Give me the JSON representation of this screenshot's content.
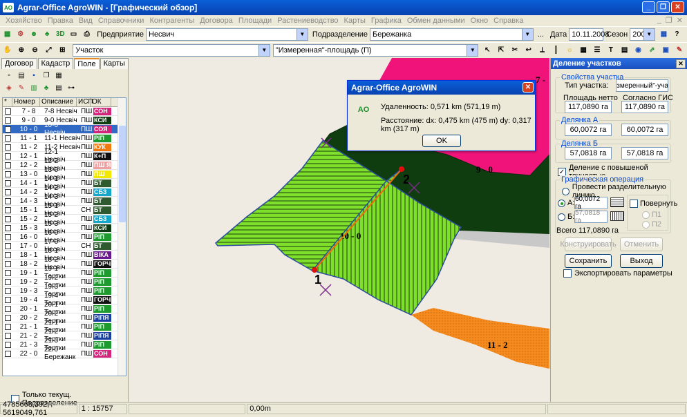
{
  "window": {
    "title": "Agrar-Office AgroWIN - [Графический обзор]",
    "app_icon": "AO"
  },
  "menu": [
    "Хозяйство",
    "Правка",
    "Вид",
    "Справочники",
    "Контрагенты",
    "Договора",
    "Площади",
    "Растениеводство",
    "Карты",
    "Графика",
    "Обмен данными",
    "Окно",
    "Справка"
  ],
  "toolbar1": {
    "enterprise_label": "Предприятие",
    "enterprise_value": "Несвич",
    "division_label": "Подразделение",
    "division_value": "Бережанка",
    "ellipsis": "...",
    "date_label": "Дата",
    "date_value": "10.11.2008",
    "season_label": "Сезон",
    "season_value": "2008"
  },
  "toolbar2": {
    "layer_value": "Участок",
    "area_value": "\"Измеренная\"-площадь (П)"
  },
  "left_panel": {
    "tabs": [
      "Договор",
      "Кадастр",
      "Поле",
      "Карты"
    ],
    "active_tab": 2,
    "columns": [
      "*",
      "Номер",
      "Описание",
      "ИСП",
      "ОК"
    ],
    "rows": [
      {
        "num": "7 - 8",
        "desc": "7-8 Несвіч",
        "isp": "ПШ",
        "ok": "СОН",
        "color": "#d4237a"
      },
      {
        "num": "9 - 0",
        "desc": "9-0 Несвіч",
        "isp": "ПШ",
        "ok": "КСИ",
        "color": "#0e3b12"
      },
      {
        "num": "10 - 0",
        "desc": "10-0 Несвіч",
        "isp": "ПШ",
        "ok": "СОЯ",
        "color": "#d4237a",
        "selected": true
      },
      {
        "num": "11 - 1",
        "desc": "11-1 Несвіч",
        "isp": "ПШ",
        "ok": "РІП",
        "color": "#1e9b2f"
      },
      {
        "num": "11 - 2",
        "desc": "11-2 Несвіч",
        "isp": "ПШ",
        "ok": "КУК",
        "color": "#f07a10"
      },
      {
        "num": "12 - 1",
        "desc": "12-1 Несвіч",
        "isp": "ПШ",
        "ok": "К+П",
        "color": "#111111"
      },
      {
        "num": "12 - 2",
        "desc": "12-2 Несвіч",
        "isp": "ПШ",
        "ok": "ПШ Я",
        "color": "#f0a0a0"
      },
      {
        "num": "13 - 0",
        "desc": "13-0 Несвіч",
        "isp": "ПШ",
        "ok": "ПШ",
        "color": "#f2e800"
      },
      {
        "num": "14 - 1",
        "desc": "14-1 Несвіч",
        "isp": "ПШ",
        "ok": "БТ",
        "color": "#2f5a2f"
      },
      {
        "num": "14 - 2",
        "desc": "14-2 Несвіч",
        "isp": "ПШ",
        "ok": "СБЗ",
        "color": "#14a7c9"
      },
      {
        "num": "14 - 3",
        "desc": "14-3 Несвіч",
        "isp": "ПШ",
        "ok": "БТ",
        "color": "#2f5a2f"
      },
      {
        "num": "15 - 1",
        "desc": "15-1 Несвіч",
        "isp": "СН",
        "ok": "БТ",
        "color": "#2f5a2f"
      },
      {
        "num": "15 - 2",
        "desc": "15-2 Несвіч",
        "isp": "ПШ",
        "ok": "СБЗ",
        "color": "#14a7c9"
      },
      {
        "num": "15 - 3",
        "desc": "15-3 Несвіч",
        "isp": "ПШ",
        "ok": "КСИ",
        "color": "#0e3b12"
      },
      {
        "num": "16 - 0",
        "desc": "16-0 Несвіч",
        "isp": "ПШ",
        "ok": "РІП",
        "color": "#1e9b2f"
      },
      {
        "num": "17 - 0",
        "desc": "17-0 Несвіч",
        "isp": "СН",
        "ok": "БТ",
        "color": "#2f5a2f"
      },
      {
        "num": "18 - 1",
        "desc": "18-1 Несвіч",
        "isp": "ПШ",
        "ok": "ВІКА",
        "color": "#6a1a8a"
      },
      {
        "num": "18 - 2",
        "desc": "18-2 Несвіч",
        "isp": "ПШ",
        "ok": "ГОРЧ",
        "color": "#111111"
      },
      {
        "num": "19 - 1",
        "desc": "19-1 Тертки",
        "isp": "ПШ",
        "ok": "РІП",
        "color": "#1e9b2f"
      },
      {
        "num": "19 - 2",
        "desc": "19-2 Тертки",
        "isp": "ПШ",
        "ok": "РІП",
        "color": "#1e9b2f"
      },
      {
        "num": "19 - 3",
        "desc": "19-3 Тертки",
        "isp": "ПШ",
        "ok": "РІП",
        "color": "#1e9b2f"
      },
      {
        "num": "19 - 4",
        "desc": "19-4 Тертки",
        "isp": "ПШ",
        "ok": "ГОРЧ",
        "color": "#111111"
      },
      {
        "num": "20 - 1",
        "desc": "20-1 Тертки",
        "isp": "ПШ",
        "ok": "РІП",
        "color": "#1e9b2f"
      },
      {
        "num": "20 - 2",
        "desc": "20-2 Тертки",
        "isp": "ПШ",
        "ok": "РІПЯ",
        "color": "#1a3fa0"
      },
      {
        "num": "21 - 1",
        "desc": "21-1 Тертки",
        "isp": "ПШ",
        "ok": "РІП",
        "color": "#1e9b2f"
      },
      {
        "num": "21 - 2",
        "desc": "21-2 Тертки",
        "isp": "ПШ",
        "ok": "РІПЯ",
        "color": "#1a3fa0"
      },
      {
        "num": "21 - 3",
        "desc": "21-3 Тертки",
        "isp": "ПШ",
        "ok": "РІП",
        "color": "#1e9b2f"
      },
      {
        "num": "22 - 0",
        "desc": "22-0 Бережанк",
        "isp": "ПШ",
        "ok": "СОН",
        "color": "#d4237a"
      }
    ],
    "only_current_label": "Только текущ. Подразделение"
  },
  "map": {
    "labels": {
      "f7": "7 -",
      "f9": "9 - 0",
      "f10": "10 - 0",
      "f11": "11 - 2",
      "p1": "1",
      "p2": "2"
    }
  },
  "dialog": {
    "title": "Agrar-Office AgroWIN",
    "distance": "Удаленность:  0,571 km (571,19 m)",
    "delta": "Расстояние: dx: 0,475 km (475 m) dy: 0,317 km (317 m)",
    "ok": "OK"
  },
  "right_panel": {
    "title": "Деление участков",
    "props_title": "Свойства участка",
    "type_label": "Тип участка:",
    "type_value": "\"Измеренный\"-участ",
    "net_label": "Площадь нетто",
    "gis_label": "Согласно ГИС",
    "net_value": "117,0890 га",
    "gis_value": "117,0890 га",
    "partA_title": "Делянка A",
    "partA_left": "60,0072 га",
    "partA_right": "60,0072 га",
    "partB_title": "Делянка Б",
    "partB_left": "57,0818 га",
    "partB_right": "57,0818 га",
    "precise_label": "Деление с повышеной точностью",
    "graph_title": "Графическая операция",
    "draw_line_label": "Провести разделительную линию",
    "a_label": "A:",
    "a_value": "60,0072 га",
    "b_label": "Б:",
    "b_value": "57,0818 га",
    "rotate_label": "Повернуть",
    "p1_label": "П1",
    "p2_label": "П2",
    "total_label": "Всего",
    "total_value": "117,0890 га",
    "construct_btn": "Конструировать",
    "cancel_btn": "Отменить",
    "save_btn": "Сохранить",
    "exit_btn": "Выход",
    "export_label": "Экспортировать параметры"
  },
  "status": {
    "coords": "4785668,392; 5619049,761",
    "scale": "1 : 15757",
    "distance": "0,00m"
  }
}
